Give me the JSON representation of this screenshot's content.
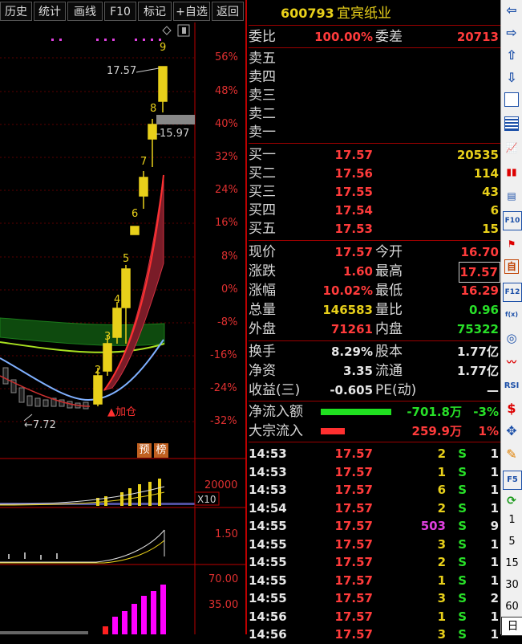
{
  "toolbar": {
    "buttons": [
      "历史",
      "统计",
      "画线",
      "F10",
      "标记",
      "+自选",
      "返回"
    ]
  },
  "chart": {
    "pct_ticks": [
      "56%",
      "48%",
      "40%",
      "32%",
      "24%",
      "16%",
      "8%",
      "0%",
      "-8%",
      "-16%",
      "-24%",
      "-32%"
    ],
    "high_price": "17.57",
    "gap_price": "15.97",
    "low_price": "7.72",
    "day_numbers": [
      "2",
      "3",
      "4",
      "5",
      "6",
      "7",
      "8",
      "9"
    ],
    "add_position_label": "加仓",
    "badge_1": "预",
    "badge_2": "榜",
    "vol_tick": "20000",
    "vol_unit": "X10",
    "ind1_tick": "1.50",
    "ind2_tick_high": "70.00",
    "ind2_tick_low": "35.00",
    "colors": {
      "candle_up": "#e8d01a",
      "ma_green": "#1a6a1a",
      "ribbon_red": "#c03040",
      "line_blue": "#7fb0ff",
      "bar_magenta": "#ff00ff"
    }
  },
  "quote": {
    "code": "600793",
    "name": "宜宾纸业",
    "weibi_label": "委比",
    "weibi": "100.00%",
    "weicha_label": "委差",
    "weicha": "20713",
    "sell_labels": [
      "卖五",
      "卖四",
      "卖三",
      "卖二",
      "卖一"
    ],
    "buys": [
      {
        "label": "买一",
        "price": "17.57",
        "vol": "20535"
      },
      {
        "label": "买二",
        "price": "17.56",
        "vol": "114"
      },
      {
        "label": "买三",
        "price": "17.55",
        "vol": "43"
      },
      {
        "label": "买四",
        "price": "17.54",
        "vol": "6"
      },
      {
        "label": "买五",
        "price": "17.53",
        "vol": "15"
      }
    ],
    "stats": {
      "xianjia_label": "现价",
      "xianjia": "17.57",
      "jinkai_label": "今开",
      "jinkai": "16.70",
      "zhangdie_label": "涨跌",
      "zhangdie": "1.60",
      "zuigao_label": "最高",
      "zuigao": "17.57",
      "zhangfu_label": "涨幅",
      "zhangfu": "10.02%",
      "zuidi_label": "最低",
      "zuidi": "16.29",
      "zongliang_label": "总量",
      "zongliang": "146583",
      "liangbi_label": "量比",
      "liangbi": "0.96",
      "waipan_label": "外盘",
      "waipan": "71261",
      "neipan_label": "内盘",
      "neipan": "75322"
    },
    "fund": {
      "huanshou_label": "换手",
      "huanshou": "8.29%",
      "guben_label": "股本",
      "guben": "1.77亿",
      "jingzi_label": "净资",
      "jingzi": "3.35",
      "liutong_label": "流通",
      "liutong": "1.77亿",
      "shouyi_label": "收益(三)",
      "shouyi": "-0.605",
      "pe_label": "PE(动)",
      "pe": "—"
    },
    "flow": {
      "net_label": "净流入额",
      "net_value": "-701.8万",
      "net_pct": "-3%",
      "block_label": "大宗流入",
      "block_value": "259.9万",
      "block_pct": "1%"
    },
    "ticks": [
      {
        "time": "14:53",
        "price": "17.57",
        "vol": "2",
        "side": "S",
        "n": "1"
      },
      {
        "time": "14:53",
        "price": "17.57",
        "vol": "1",
        "side": "S",
        "n": "1"
      },
      {
        "time": "14:53",
        "price": "17.57",
        "vol": "6",
        "side": "S",
        "n": "1"
      },
      {
        "time": "14:54",
        "price": "17.57",
        "vol": "2",
        "side": "S",
        "n": "1"
      },
      {
        "time": "14:55",
        "price": "17.57",
        "vol": "503",
        "side": "S",
        "n": "9"
      },
      {
        "time": "14:55",
        "price": "17.57",
        "vol": "3",
        "side": "S",
        "n": "1"
      },
      {
        "time": "14:55",
        "price": "17.57",
        "vol": "2",
        "side": "S",
        "n": "1"
      },
      {
        "time": "14:55",
        "price": "17.57",
        "vol": "1",
        "side": "S",
        "n": "1"
      },
      {
        "time": "14:55",
        "price": "17.57",
        "vol": "3",
        "side": "S",
        "n": "2"
      },
      {
        "time": "14:56",
        "price": "17.57",
        "vol": "1",
        "side": "S",
        "n": "1"
      },
      {
        "time": "14:56",
        "price": "17.57",
        "vol": "3",
        "side": "S",
        "n": "1"
      }
    ]
  },
  "sidebar": {
    "icons": [
      "arrow-left-icon",
      "arrow-right-icon",
      "arrow-up-icon",
      "arrow-down-icon",
      "report-icon",
      "grid-icon",
      "line-chart-icon",
      "candle-icon",
      "window-icon",
      "f10-icon",
      "flag-icon",
      "self-select-icon",
      "f12-icon",
      "fx-icon",
      "circle-icon",
      "wave-icon",
      "rsi-icon",
      "dollar-icon",
      "move-icon",
      "pencil-icon",
      "f5-icon",
      "refresh-icon"
    ],
    "f10": "F10",
    "rsi": "RSI",
    "f12": "F12",
    "f5": "F5",
    "fx": "f(x)",
    "periods": [
      "1",
      "5",
      "15",
      "30",
      "60"
    ],
    "day": "日"
  }
}
